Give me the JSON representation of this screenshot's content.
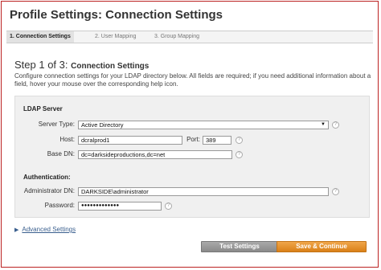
{
  "header": {
    "title": "Profile Settings: Connection Settings"
  },
  "tabs": [
    {
      "label": "1. Connection Settings",
      "active": true
    },
    {
      "label": "2. User Mapping",
      "active": false
    },
    {
      "label": "3. Group Mapping",
      "active": false
    }
  ],
  "step": {
    "prefix": "Step 1 of 3:",
    "title": "Connection Settings",
    "description": "Configure connection settings for your LDAP directory below. All fields are required; if you need additional information about a field, hover your mouse over the corresponding help icon."
  },
  "ldap": {
    "section_title": "LDAP Server",
    "server_type_label": "Server Type:",
    "server_type_value": "Active Directory",
    "host_label": "Host:",
    "host_value": "dcralprod1",
    "port_label": "Port:",
    "port_value": "389",
    "base_dn_label": "Base DN:",
    "base_dn_value": "dc=darksideproductions,dc=net"
  },
  "auth": {
    "section_title": "Authentication:",
    "admin_dn_label": "Administrator DN:",
    "admin_dn_value": "DARKSIDE\\administrator",
    "password_label": "Password:",
    "password_value": "●●●●●●●●●●●●●"
  },
  "advanced": {
    "label": "Advanced Settings"
  },
  "buttons": {
    "test": "Test Settings",
    "save": "Save & Continue"
  },
  "icons": {
    "help": "?",
    "dropdown": "▼",
    "expand": "▶"
  },
  "colors": {
    "save_button": "#e08a22",
    "test_button": "#999999",
    "link": "#3a5f8e",
    "frame": "#bb2222"
  }
}
